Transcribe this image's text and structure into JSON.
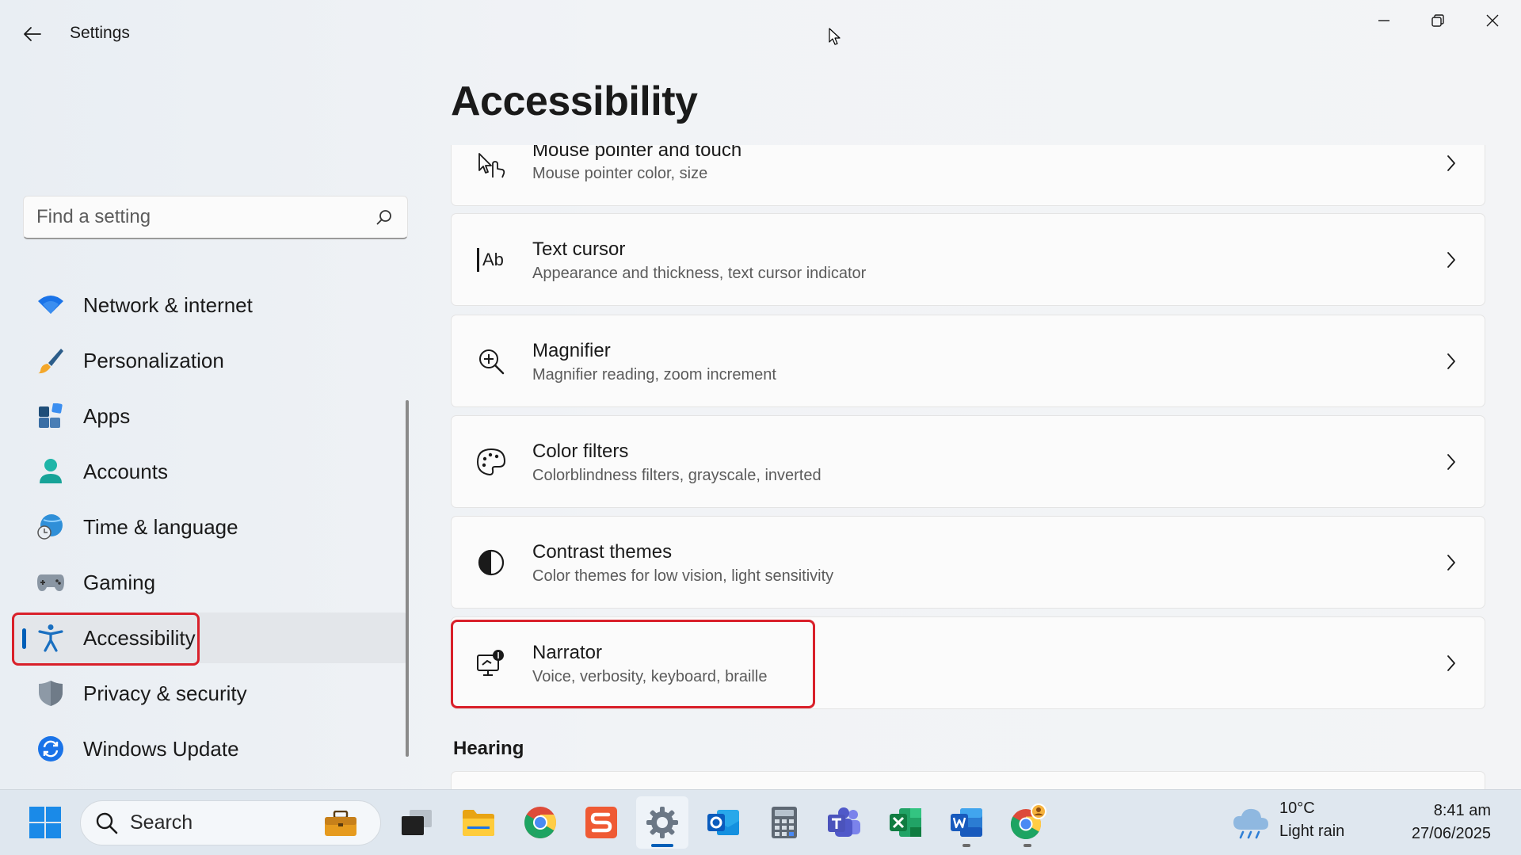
{
  "window": {
    "title": "Settings"
  },
  "sidebar": {
    "search": {
      "placeholder": "Find a setting",
      "value": ""
    },
    "items": [
      {
        "label": "Network & internet",
        "icon": "wifi-icon"
      },
      {
        "label": "Personalization",
        "icon": "brush-icon"
      },
      {
        "label": "Apps",
        "icon": "apps-icon"
      },
      {
        "label": "Accounts",
        "icon": "person-icon"
      },
      {
        "label": "Time & language",
        "icon": "globe-clock-icon"
      },
      {
        "label": "Gaming",
        "icon": "gamepad-icon"
      },
      {
        "label": "Accessibility",
        "icon": "accessibility-icon",
        "selected": true
      },
      {
        "label": "Privacy & security",
        "icon": "shield-icon"
      },
      {
        "label": "Windows Update",
        "icon": "update-icon"
      }
    ]
  },
  "main": {
    "title": "Accessibility",
    "cards": [
      {
        "title": "Mouse pointer and touch",
        "description": "Mouse pointer color, size",
        "icon": "mouse-pointer-icon"
      },
      {
        "title": "Text cursor",
        "description": "Appearance and thickness, text cursor indicator",
        "icon": "text-cursor-icon"
      },
      {
        "title": "Magnifier",
        "description": "Magnifier reading, zoom increment",
        "icon": "magnifier-icon"
      },
      {
        "title": "Color filters",
        "description": "Colorblindness filters, grayscale, inverted",
        "icon": "palette-icon"
      },
      {
        "title": "Contrast themes",
        "description": "Color themes for low vision, light sensitivity",
        "icon": "contrast-icon"
      },
      {
        "title": "Narrator",
        "description": "Voice, verbosity, keyboard, braille",
        "icon": "narrator-icon"
      }
    ],
    "section_heading": "Hearing"
  },
  "taskbar": {
    "search_label": "Search",
    "apps": [
      "start-icon",
      "work-briefcase-icon",
      "task-view-icon",
      "file-explorer-icon",
      "chrome-icon",
      "sketchbook-icon",
      "settings-icon",
      "outlook-icon",
      "calculator-icon",
      "teams-icon",
      "excel-icon",
      "word-icon",
      "chrome-profile-icon"
    ],
    "weather": {
      "temperature": "10°C",
      "condition": "Light rain"
    },
    "clock": {
      "time": "8:41 am",
      "date": "27/06/2025"
    }
  },
  "colors": {
    "accent": "#005fb8",
    "highlight": "#d9202a",
    "background": "#f3f4f6",
    "card": "#fbfbfb"
  }
}
